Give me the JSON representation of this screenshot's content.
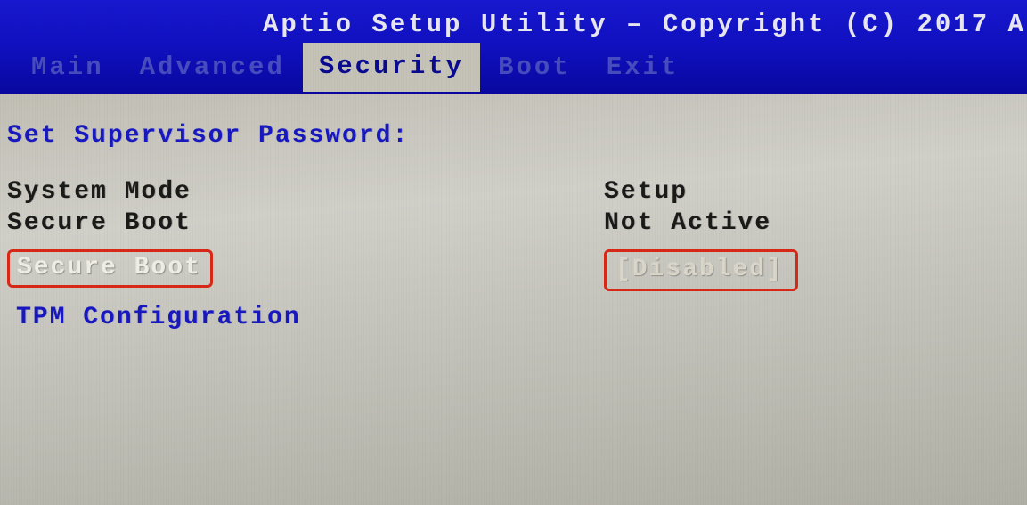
{
  "header": {
    "title": "Aptio Setup Utility – Copyright (C) 2017 A"
  },
  "tabs": {
    "main": "Main",
    "advanced": "Advanced",
    "security": "Security",
    "boot": "Boot",
    "exit": "Exit"
  },
  "security": {
    "set_supervisor_label": "Set Supervisor Password:",
    "system_mode_label": "System Mode",
    "system_mode_value": "Setup",
    "secure_boot_state_label": "Secure Boot",
    "secure_boot_state_value": "Not Active",
    "secure_boot_option_label": "Secure Boot",
    "secure_boot_option_value": "[Disabled]",
    "tpm_config_label": "TPM Configuration"
  }
}
